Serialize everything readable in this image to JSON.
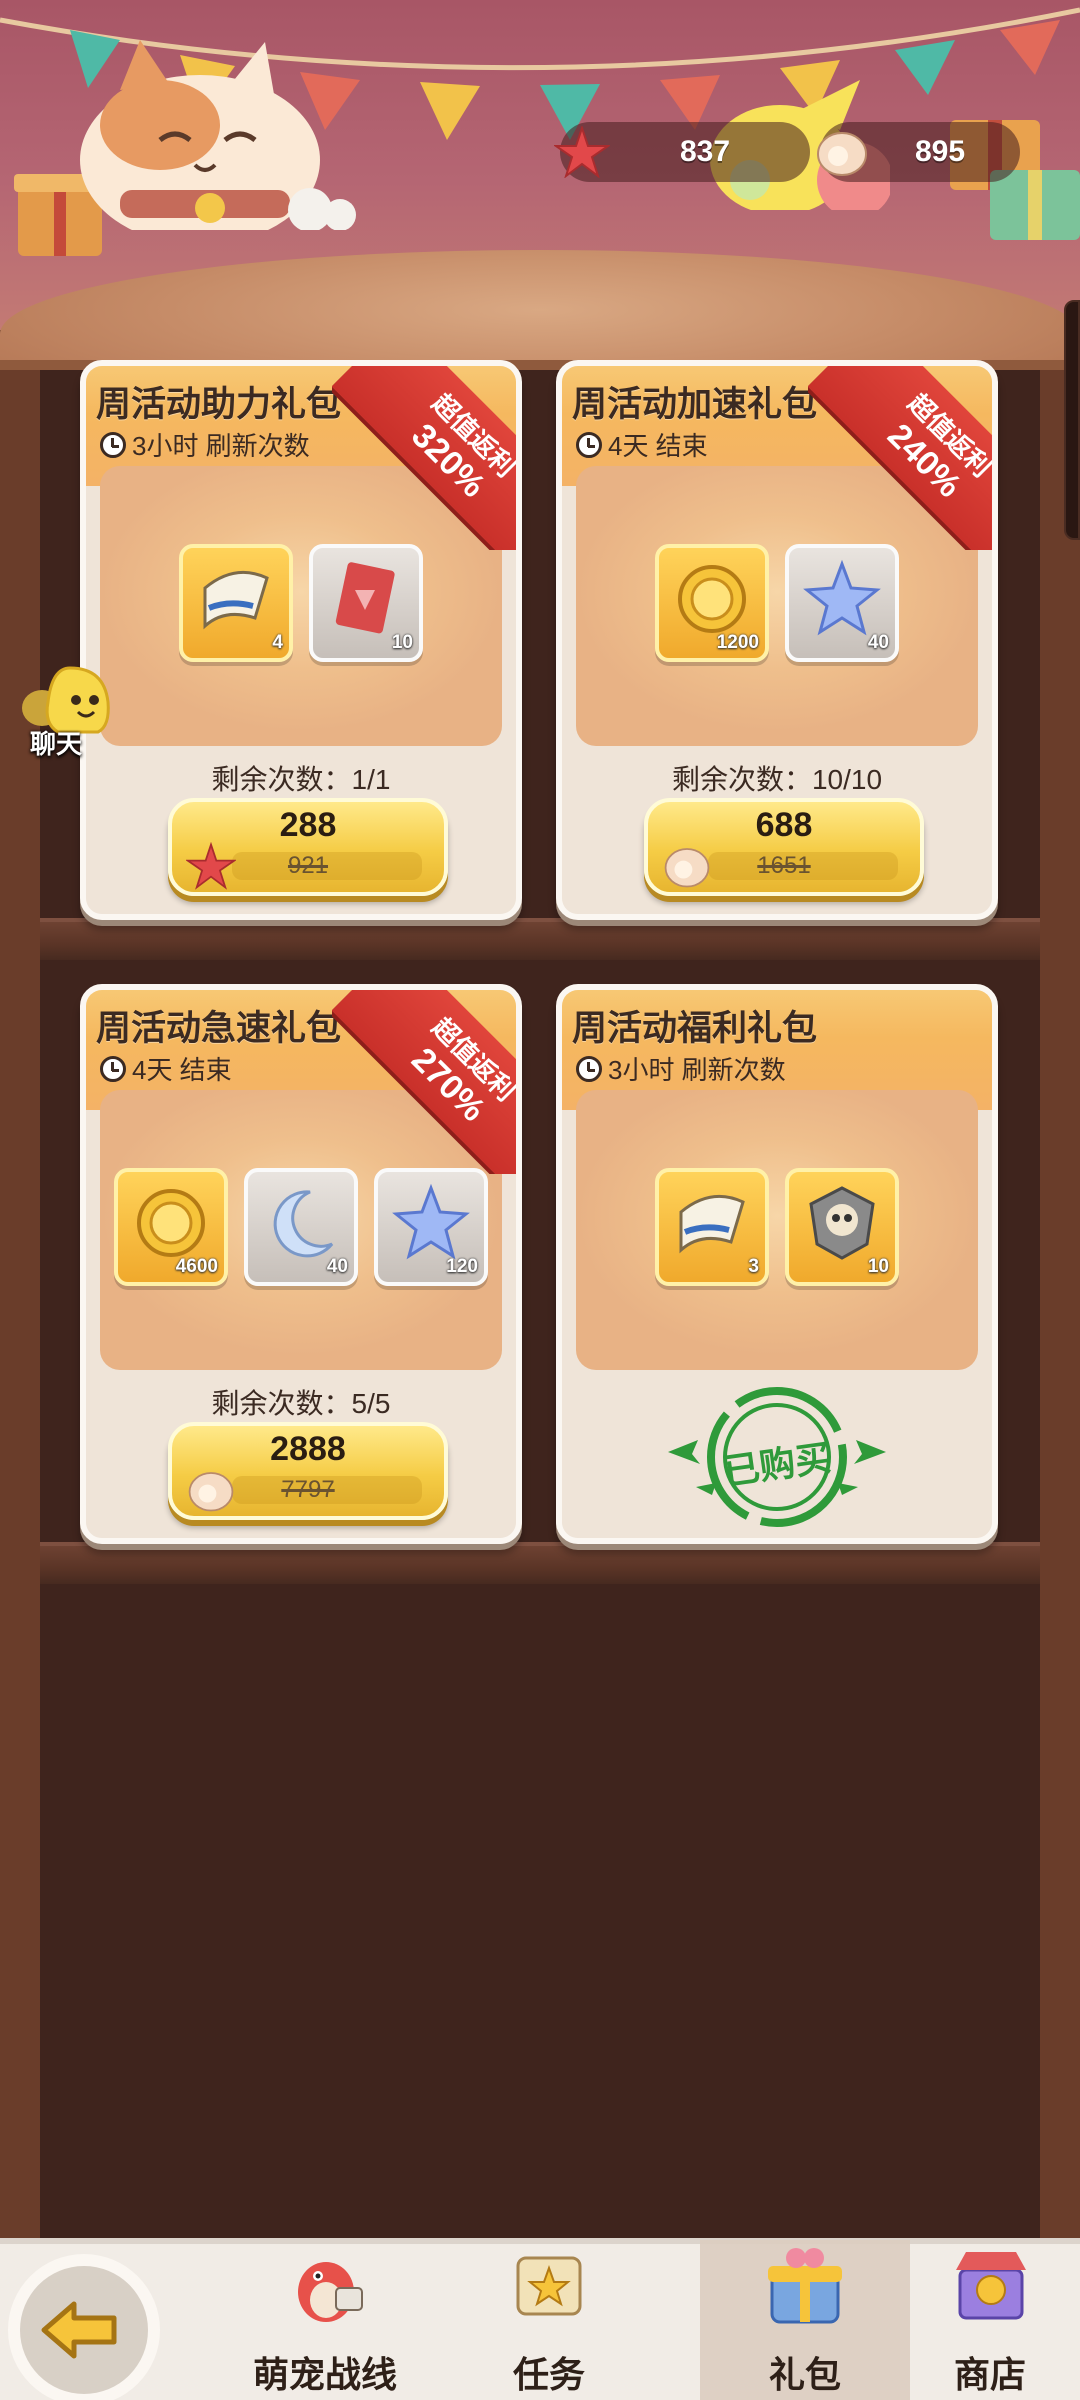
{
  "currency": {
    "starfish": "837",
    "shell": "895"
  },
  "chat": {
    "label": "聊天"
  },
  "packs": [
    {
      "title": "周活动助力礼包",
      "timer": "3小时 刷新次数",
      "ribbon_line1": "超值返利",
      "ribbon_line2": "320%",
      "items": [
        {
          "icon": "scroll-icon",
          "qty": "4"
        },
        {
          "icon": "ticket-icon",
          "qty": "10"
        }
      ],
      "remaining": "剩余次数：1/1",
      "price": "288",
      "original_price": "921",
      "currency_icon": "starfish-icon"
    },
    {
      "title": "周活动加速礼包",
      "timer": "4天 结束",
      "ribbon_line1": "超值返利",
      "ribbon_line2": "240%",
      "items": [
        {
          "icon": "gold-coin-icon",
          "qty": "1200"
        },
        {
          "icon": "blue-star-icon",
          "qty": "40"
        }
      ],
      "remaining": "剩余次数：10/10",
      "price": "688",
      "original_price": "1651",
      "currency_icon": "shell-icon"
    },
    {
      "title": "周活动急速礼包",
      "timer": "4天 结束",
      "ribbon_line1": "超值返利",
      "ribbon_line2": "270%",
      "items": [
        {
          "icon": "gold-coin-icon",
          "qty": "4600"
        },
        {
          "icon": "moon-icon",
          "qty": "40"
        },
        {
          "icon": "blue-star-icon",
          "qty": "120"
        }
      ],
      "remaining": "剩余次数：5/5",
      "price": "2888",
      "original_price": "7797",
      "currency_icon": "shell-icon"
    },
    {
      "title": "周活动福利礼包",
      "timer": "3小时 刷新次数",
      "items": [
        {
          "icon": "scroll-icon",
          "qty": "3"
        },
        {
          "icon": "skull-shield-icon",
          "qty": "10"
        }
      ],
      "status": "已购买"
    }
  ],
  "nav": {
    "back_icon": "back-arrow-icon",
    "items": [
      {
        "label": "萌宠战线",
        "icon": "dino-pet-icon",
        "active": false
      },
      {
        "label": "任务",
        "icon": "scroll-task-icon",
        "active": false
      },
      {
        "label": "礼包",
        "icon": "gift-box-icon",
        "active": true
      },
      {
        "label": "商店",
        "icon": "shop-icon",
        "active": false
      }
    ]
  },
  "colors": {
    "card_header": "#f5b85f",
    "ribbon": "#d93a32",
    "price_button": "#f5cc45",
    "stamp_green": "#2f9a3a",
    "cabinet": "#3f241d"
  }
}
